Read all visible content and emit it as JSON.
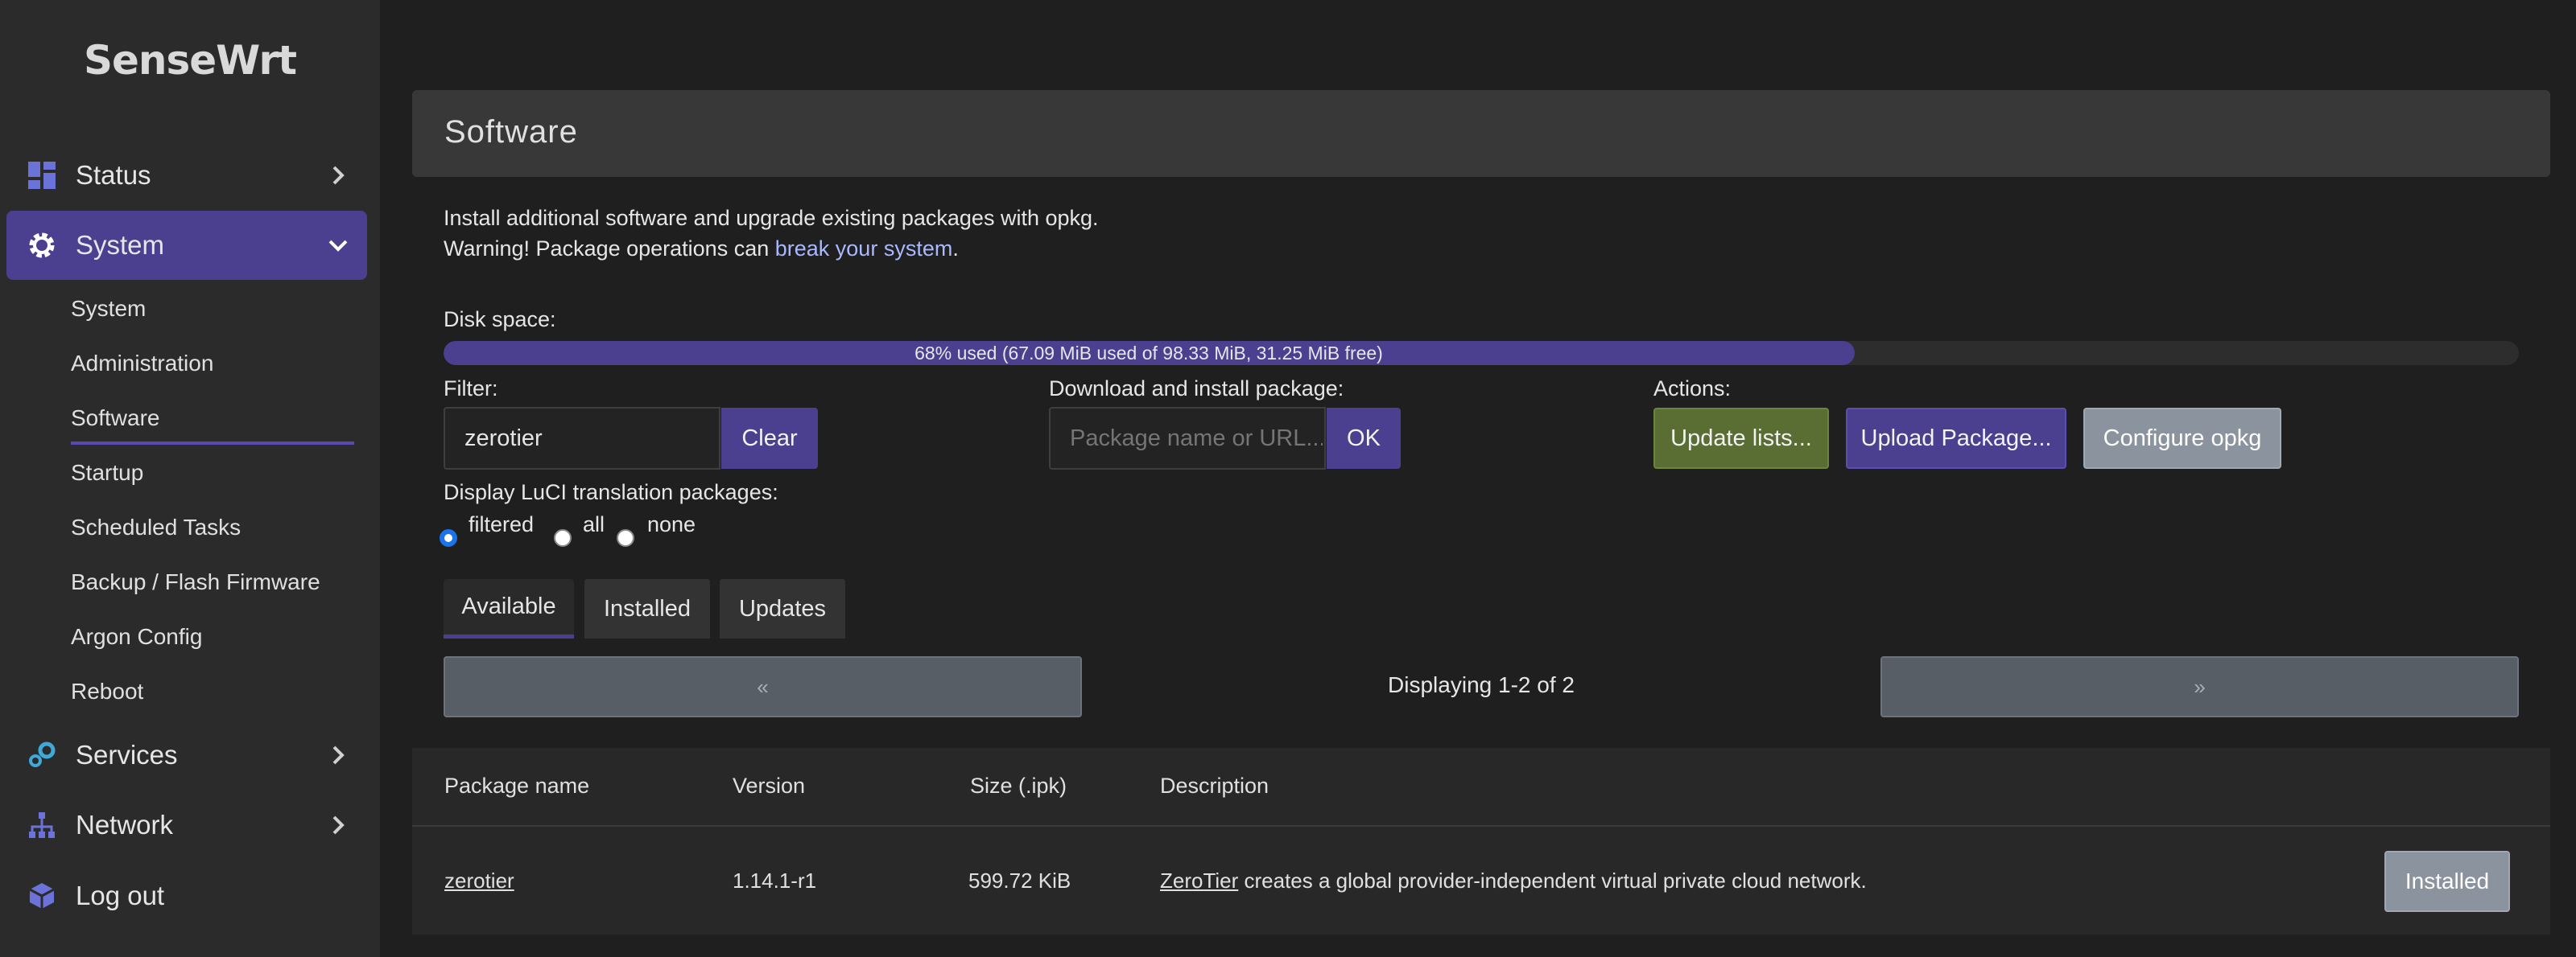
{
  "app": {
    "logo": "SenseWrt"
  },
  "sidebar": {
    "status": "Status",
    "system": "System",
    "sub_items": [
      "System",
      "Administration",
      "Software",
      "Startup",
      "Scheduled Tasks",
      "Backup / Flash Firmware",
      "Argon Config",
      "Reboot"
    ],
    "services": "Services",
    "network": "Network",
    "logout": "Log out"
  },
  "page": {
    "title": "Software",
    "intro_line1": "Install additional software and upgrade existing packages with opkg.",
    "warning_prefix": "Warning! Package operations can ",
    "warning_link": "break your system",
    "warning_suffix": "."
  },
  "disk": {
    "label": "Disk space:",
    "used_fraction": 0.68,
    "text": "68% used (67.09 MiB used of 98.33 MiB, 31.25 MiB free)"
  },
  "filter": {
    "label": "Filter:",
    "value": "zerotier",
    "clear_label": "Clear"
  },
  "download": {
    "label": "Download and install package:",
    "placeholder": "Package name or URL...",
    "ok_label": "OK"
  },
  "actions": {
    "label": "Actions:",
    "update_lists": "Update lists...",
    "upload_package": "Upload Package...",
    "configure_opkg": "Configure opkg"
  },
  "translation": {
    "label": "Display LuCI translation packages:",
    "options": [
      "filtered",
      "all",
      "none"
    ],
    "selected": "filtered"
  },
  "tabs": [
    "Available",
    "Installed",
    "Updates"
  ],
  "pager": {
    "prev": "«",
    "next": "»",
    "status": "Displaying 1-2 of 2"
  },
  "table": {
    "headers": [
      "Package name",
      "Version",
      "Size (.ipk)",
      "Description"
    ],
    "rows": [
      {
        "name": "zerotier",
        "version": "1.14.1-r1",
        "size": "599.72 KiB",
        "desc_link": "ZeroTier",
        "desc_rest": " creates a global provider-independent virtual private cloud network.",
        "action": "Installed"
      }
    ]
  },
  "colors": {
    "accent": "#4b3f8f",
    "sidebar_bg": "#2b2b2b",
    "page_bg": "#1f1f1f",
    "green_button": "#5a6e34",
    "grey_button": "#8b949e"
  }
}
